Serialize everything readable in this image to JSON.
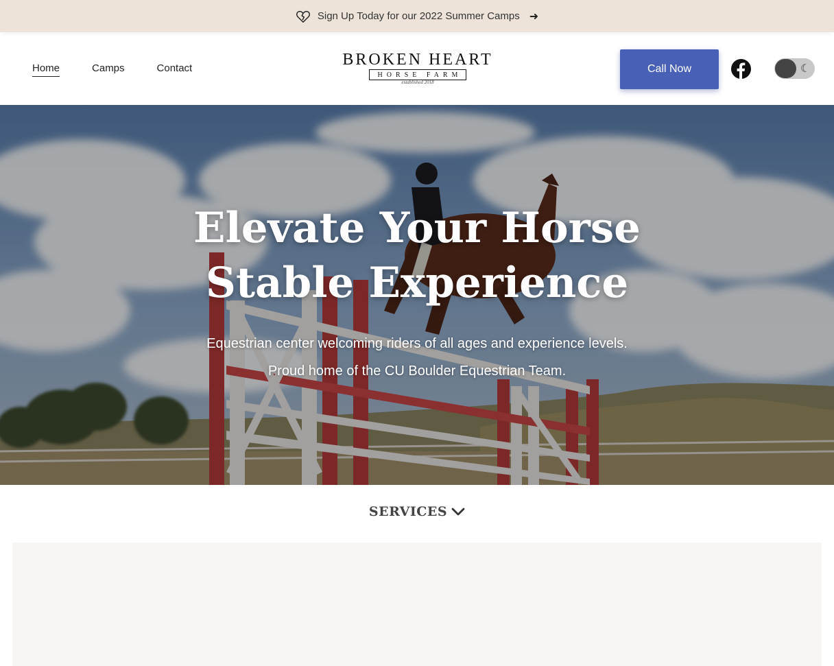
{
  "announcement": {
    "text": "Sign Up Today for our 2022 Summer Camps",
    "icon": "broken-heart-icon",
    "arrow_icon": "arrow-right-icon",
    "background": "#ede3d8"
  },
  "nav": {
    "items": [
      {
        "label": "Home",
        "active": true
      },
      {
        "label": "Camps",
        "active": false
      },
      {
        "label": "Contact",
        "active": false
      }
    ]
  },
  "logo": {
    "line1": "BROKEN HEART",
    "line2": "HORSE FARM",
    "line3": "established 2018"
  },
  "header": {
    "call_label": "Call Now",
    "call_color": "#4860b6",
    "social_icon": "facebook-icon",
    "theme_toggle_icon": "moon-icon"
  },
  "hero": {
    "title_line1": "Elevate Your Horse",
    "title_line2": "Stable Experience",
    "subtitle_line1": "Equestrian center welcoming riders of all ages and experience levels.",
    "subtitle_line2": "Proud home of the CU Boulder Equestrian Team."
  },
  "services": {
    "label": "SERVICES",
    "icon": "chevron-down-icon"
  }
}
